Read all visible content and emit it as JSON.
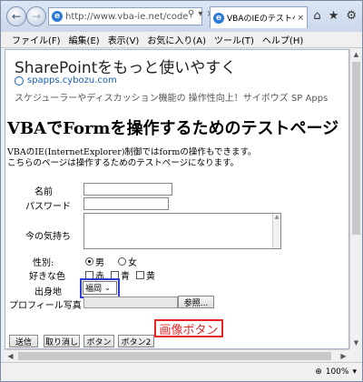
{
  "browser": {
    "address": "http://www.vba-ie.net/code",
    "tab_title": "VBAのIEのテストペー…",
    "menu": [
      "ファイル(F)",
      "編集(E)",
      "表示(V)",
      "お気に入り(A)",
      "ツール(T)",
      "ヘルプ(H)"
    ],
    "zoom": "100%"
  },
  "ad": {
    "title": "SharePointをもっと使いやすく",
    "url": "spapps.cybozu.com",
    "desc": "スケジューラーやディスカッション機能の 操作性向上！サイボウズ SP Apps"
  },
  "page": {
    "title": "VBAでFormを操作するためのテストページ",
    "desc_line1": "VBAのIE(InternetExplorer)制御ではformの操作もできます。",
    "desc_line2": "こちらのページは操作するためのテストページになります。"
  },
  "form": {
    "name_label": "名前",
    "password_label": "パスワード",
    "feeling_label": "今の気持ち",
    "gender_label": "性別:",
    "gender_options": [
      "男",
      "女"
    ],
    "gender_selected": "男",
    "color_label": "好きな色",
    "color_options": [
      "赤",
      "青",
      "黄"
    ],
    "birthplace_label": "出身地",
    "birthplace_value": "福岡",
    "photo_label": "プロフィール写真",
    "browse_label": "参照...",
    "image_button_label": "画像ボタン",
    "buttons": [
      "送信",
      "取り消し",
      "ボタン",
      "ボタン2"
    ]
  }
}
